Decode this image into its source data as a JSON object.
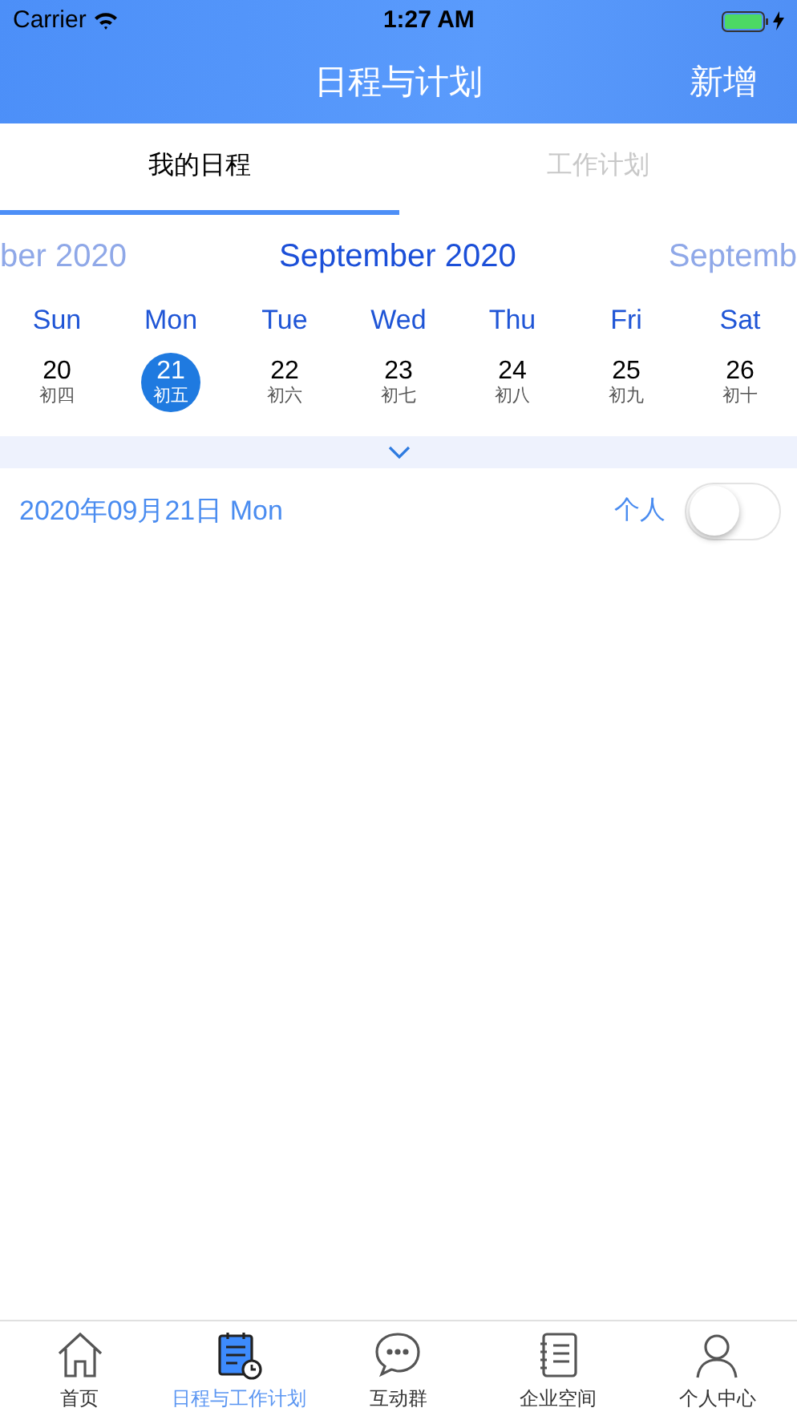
{
  "status_bar": {
    "carrier": "Carrier",
    "time": "1:27 AM"
  },
  "nav": {
    "title": "日程与计划",
    "action": "新增"
  },
  "tabs": [
    {
      "label": "我的日程",
      "selected": true
    },
    {
      "label": "工作计划",
      "selected": false
    }
  ],
  "months": [
    {
      "label": "ber 2020",
      "selected": false
    },
    {
      "label": "September 2020",
      "selected": true
    },
    {
      "label": "Septemb",
      "selected": false
    }
  ],
  "weekdays": [
    "Sun",
    "Mon",
    "Tue",
    "Wed",
    "Thu",
    "Fri",
    "Sat"
  ],
  "days": [
    {
      "day": "20",
      "lunar": "初四",
      "selected": false
    },
    {
      "day": "21",
      "lunar": "初五",
      "selected": true
    },
    {
      "day": "22",
      "lunar": "初六",
      "selected": false
    },
    {
      "day": "23",
      "lunar": "初七",
      "selected": false
    },
    {
      "day": "24",
      "lunar": "初八",
      "selected": false
    },
    {
      "day": "25",
      "lunar": "初九",
      "selected": false
    },
    {
      "day": "26",
      "lunar": "初十",
      "selected": false
    }
  ],
  "date_row": {
    "date": "2020年09月21日 Mon",
    "toggle_label": "个人",
    "on": false
  },
  "tab_bar": [
    {
      "label": "首页",
      "selected": false
    },
    {
      "label": "日程与工作计划",
      "selected": true
    },
    {
      "label": "互动群",
      "selected": false
    },
    {
      "label": "企业空间",
      "selected": false
    },
    {
      "label": "个人中心",
      "selected": false
    }
  ]
}
